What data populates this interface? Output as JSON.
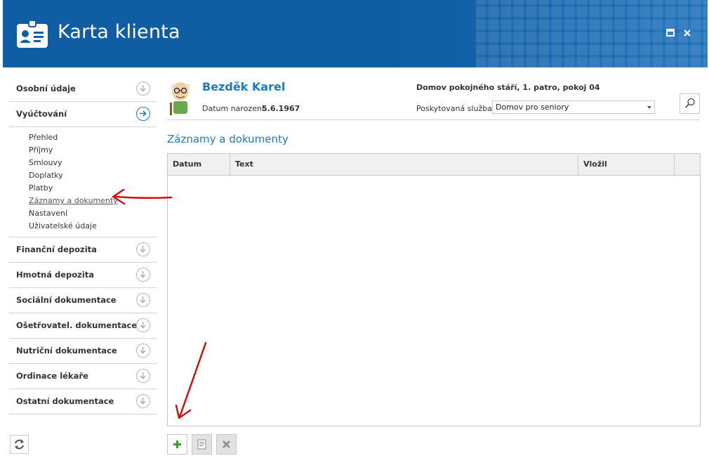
{
  "window": {
    "title": "Karta klienta",
    "maximize_icon": "maximize-icon",
    "close_icon": "close-icon"
  },
  "sidebar": {
    "sections": [
      {
        "label": "Osobní údaje",
        "expanded": false
      },
      {
        "label": "Vyúčtování",
        "expanded": true,
        "items": [
          "Přehled",
          "Příjmy",
          "Smlouvy",
          "Doplatky",
          "Platby",
          "Záznamy a dokumenty",
          "Nastavení",
          "Uživatelské údaje"
        ],
        "selected": "Záznamy a dokumenty"
      },
      {
        "label": "Finanční depozita",
        "expanded": false
      },
      {
        "label": "Hmotná depozita",
        "expanded": false
      },
      {
        "label": "Sociální dokumentace",
        "expanded": false
      },
      {
        "label": "Ošetřovatel. dokumentace",
        "expanded": false
      },
      {
        "label": "Nutriční dokumentace",
        "expanded": false
      },
      {
        "label": "Ordinace lékaře",
        "expanded": false
      },
      {
        "label": "Ostatní dokumentace",
        "expanded": false
      }
    ]
  },
  "client": {
    "name": "Bezděk Karel",
    "dob_label": "Datum narození:",
    "dob_value": "5.6.1967",
    "facility": "Domov pokojného stáří, 1. patro, pokoj 04",
    "service_label": "Poskytovaná služba:",
    "service_value": "Domov pro seniory"
  },
  "main": {
    "section_title": "Záznamy a dokumenty",
    "columns": [
      "Datum",
      "Text",
      "Vložil",
      ""
    ],
    "rows": []
  },
  "toolbar": {
    "add_icon": "plus-icon",
    "edit_icon": "document-edit-icon",
    "delete_icon": "delete-x-icon"
  },
  "colors": {
    "titlebar": "#0f5da3",
    "accent": "#1c7bc4",
    "annotation": "#cc1111",
    "add_green": "#3aa12e"
  }
}
